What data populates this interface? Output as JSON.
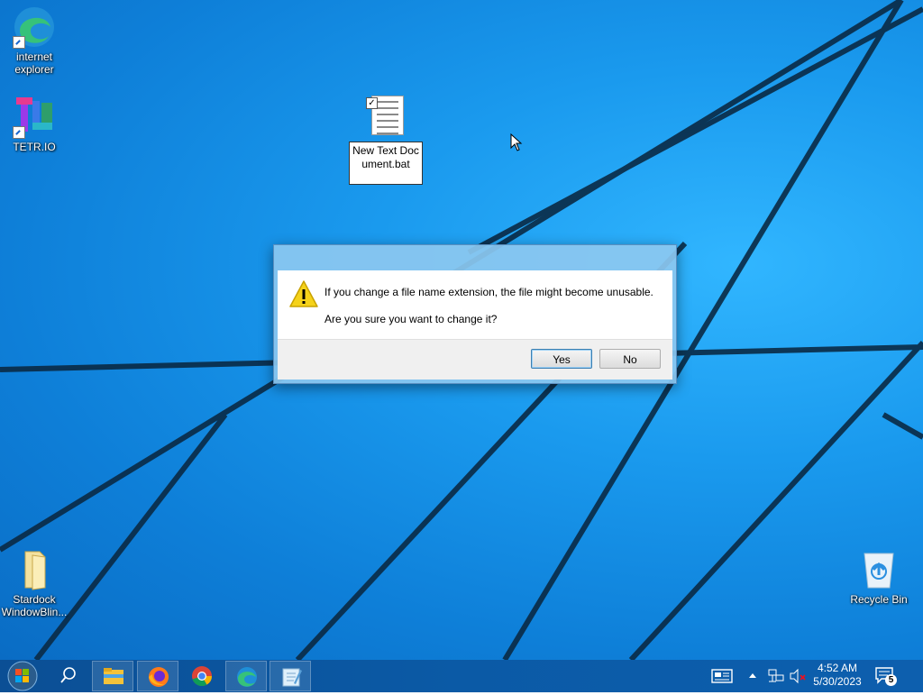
{
  "desktop": {
    "icons": [
      {
        "label": "internet explorer",
        "icon": "edge-icon"
      },
      {
        "label": "TETR.IO",
        "icon": "tetrio-icon"
      },
      {
        "label": "Stardock WindowBlin...",
        "icon": "folder-icon"
      },
      {
        "label": "Recycle Bin",
        "icon": "recycle-bin-icon"
      }
    ],
    "renaming_file": {
      "icon": "text-file-icon",
      "name_value": "New Text Document.bat"
    }
  },
  "dialog": {
    "icon": "warning-icon",
    "message": "If you change a file name extension, the file might become unusable.",
    "question": "Are you sure you want to change it?",
    "yes_label": "Yes",
    "no_label": "No"
  },
  "taskbar": {
    "buttons": [
      {
        "icon": "windows-start-icon"
      },
      {
        "icon": "search-icon"
      },
      {
        "icon": "file-explorer-icon"
      },
      {
        "icon": "firefox-icon"
      },
      {
        "icon": "chrome-icon"
      },
      {
        "icon": "edge-icon"
      },
      {
        "icon": "notepad-icon"
      }
    ],
    "tray": {
      "time": "4:52 AM",
      "date": "5/30/2023",
      "notification_count": "5",
      "icons": [
        "news-icon",
        "chevron-up-icon",
        "network-icon",
        "volume-muted-icon",
        "notification-icon"
      ]
    }
  },
  "colors": {
    "desktop_blue": "#1a9aee",
    "taskbar": "#0b5aa6",
    "dialog_frame": "#8cc8f0",
    "warning_yellow": "#f5d21a"
  }
}
